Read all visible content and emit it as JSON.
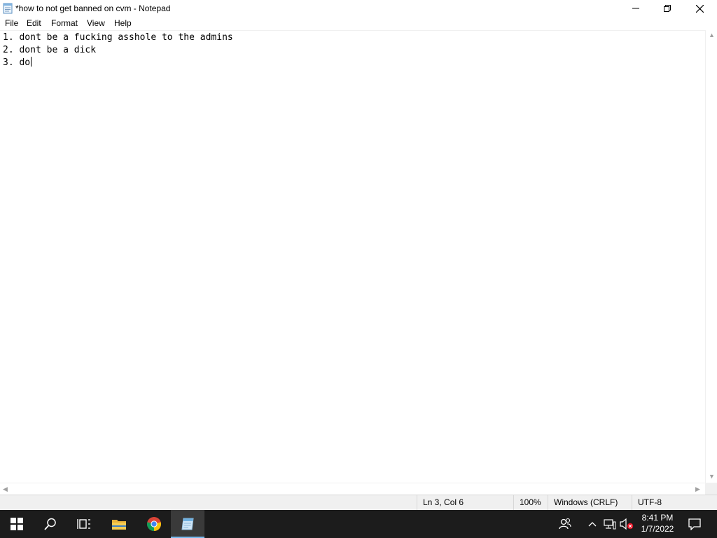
{
  "window": {
    "title": "*how to not get banned on cvm - Notepad"
  },
  "menu": [
    "File",
    "Edit",
    "Format",
    "View",
    "Help"
  ],
  "editor": {
    "lines": [
      "1. dont be a fucking asshole to the admins",
      "2. dont be a dick",
      "3. do"
    ]
  },
  "status": {
    "position": "Ln 3, Col 6",
    "zoom": "100%",
    "line_ending": "Windows (CRLF)",
    "encoding": "UTF-8"
  },
  "taskbar": {
    "time": "8:41 PM",
    "date": "1/7/2022",
    "accent": "#76b9ed"
  }
}
